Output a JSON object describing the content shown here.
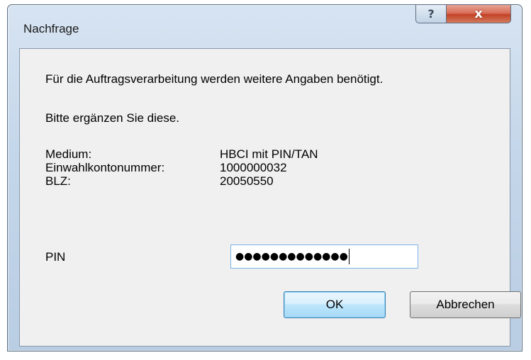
{
  "window": {
    "title": "Nachfrage",
    "help_glyph": "?",
    "close_glyph": "x"
  },
  "message": {
    "line1": "Für die Auftragsverarbeitung werden weitere Angaben benötigt.",
    "line2": "Bitte ergänzen Sie diese."
  },
  "details": [
    {
      "label": "Medium:",
      "value": "HBCI mit PIN/TAN"
    },
    {
      "label": "Einwahlkontonummer:",
      "value": "1000000032"
    },
    {
      "label": "BLZ:",
      "value": "20050550"
    }
  ],
  "pin": {
    "label": "PIN",
    "masked_value": "●●●●●●●●●●●●●"
  },
  "buttons": {
    "ok": "OK",
    "cancel": "Abbrechen"
  },
  "icons": {
    "help": "help-icon",
    "close": "close-icon"
  }
}
